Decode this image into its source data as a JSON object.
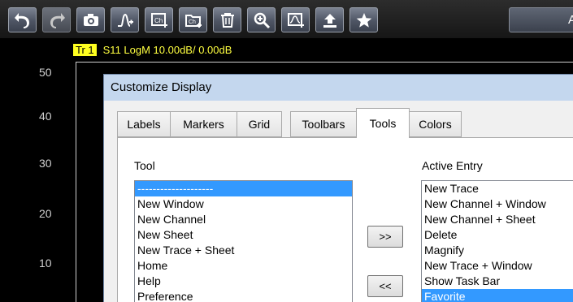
{
  "toolbar": {
    "buttons": [
      {
        "icon": "undo-icon"
      },
      {
        "icon": "redo-icon",
        "disabled": true
      },
      {
        "icon": "camera-icon"
      },
      {
        "icon": "new-trace-icon"
      },
      {
        "icon": "new-channel-icon"
      },
      {
        "icon": "new-channel-sheet-icon"
      },
      {
        "icon": "delete-icon"
      },
      {
        "icon": "magnify-icon"
      },
      {
        "icon": "new-trace-window-icon"
      },
      {
        "icon": "upload-icon"
      },
      {
        "icon": "favorite-star-icon"
      }
    ],
    "wide_label": "A"
  },
  "chart": {
    "trace_id": "Tr 1",
    "trace_desc": "S11 LogM 10.00dB/  0.00dB",
    "y_ticks": [
      "50",
      "40",
      "30",
      "20",
      "10"
    ]
  },
  "dialog": {
    "title": "Customize Display",
    "tabs": [
      "Labels",
      "Markers",
      "Grid",
      "Toolbars",
      "Tools",
      "Colors"
    ],
    "active_tab": "Tools",
    "tool_label": "Tool",
    "active_label": "Active Entry",
    "tool_items": [
      "--------------------",
      "New Window",
      "New Channel",
      "New Sheet",
      "New Trace + Sheet",
      "Home",
      "Help",
      "Preference"
    ],
    "active_items": [
      "New Trace",
      "New Channel + Window",
      "New Channel + Sheet",
      "Delete",
      "Magnify",
      "New Trace + Window",
      "Show Task Bar",
      "Favorite"
    ],
    "add_button": ">>",
    "remove_button": "<<"
  }
}
